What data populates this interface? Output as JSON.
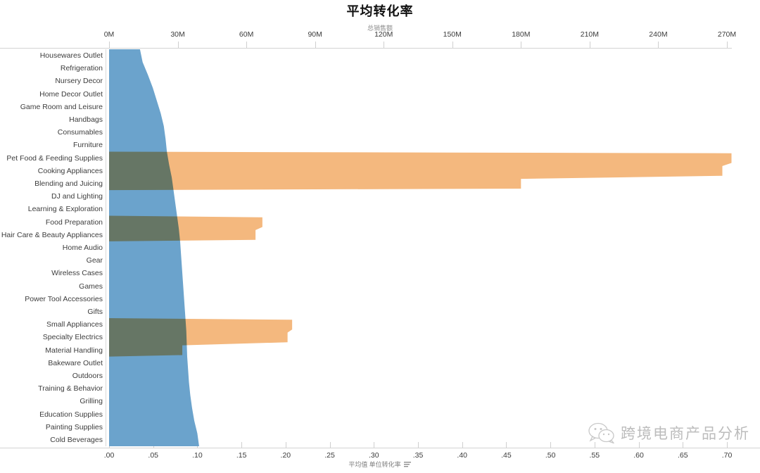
{
  "chart": {
    "title": "平均转化率",
    "top_axis_label": "总销售额",
    "bottom_axis_label": "平均值 单位转化率",
    "sort_icon": "sort-descending-icon"
  },
  "watermark": {
    "text": "跨境电商产品分析",
    "logo": "wechat-logo-icon"
  },
  "colors": {
    "blue": "#6ba3cc",
    "orange": "#f4b87e",
    "overlap": "#c09a68",
    "axis": "#d3d3d3",
    "text": "#3d3d3d"
  },
  "chart_data": {
    "type": "area",
    "orientation": "horizontal",
    "title": "平均转化率",
    "xlabel": "平均值 单位转化率",
    "x2label": "总销售额",
    "ylabel": "",
    "grid": false,
    "legend": null,
    "bottom_axis": {
      "name": "平均值 单位转化率",
      "ticks": [
        ".00",
        ".05",
        ".10",
        ".15",
        ".20",
        ".25",
        ".30",
        ".35",
        ".40",
        ".45",
        ".50",
        ".55",
        ".60",
        ".65",
        ".70"
      ],
      "tick_values": [
        0.0,
        0.05,
        0.1,
        0.15,
        0.2,
        0.25,
        0.3,
        0.35,
        0.4,
        0.45,
        0.5,
        0.55,
        0.6,
        0.65,
        0.7
      ],
      "range": [
        0.0,
        0.7
      ]
    },
    "top_axis": {
      "name": "总销售额",
      "ticks": [
        "0M",
        "30M",
        "60M",
        "90M",
        "120M",
        "150M",
        "180M",
        "210M",
        "240M",
        "270M"
      ],
      "tick_values": [
        0,
        30000000,
        60000000,
        90000000,
        120000000,
        150000000,
        180000000,
        210000000,
        240000000,
        270000000
      ],
      "range": [
        0,
        270000000
      ]
    },
    "categories": [
      "Housewares Outlet",
      "Refrigeration",
      "Nursery Decor",
      "Home Decor Outlet",
      "Game Room and Leisure",
      "Handbags",
      "Consumables",
      "Furniture",
      "Pet Food & Feeding Supplies",
      "Cooking Appliances",
      "Blending and Juicing",
      "DJ and Lighting",
      "Learning & Exploration",
      "Food Preparation",
      "Hair Care & Beauty Appliances",
      "Home Audio",
      "Gear",
      "Wireless Cases",
      "Games",
      "Power Tool Accessories",
      "Gifts",
      "Small Appliances",
      "Specialty Electrics",
      "Material Handling",
      "Bakeware Outlet",
      "Outdoors",
      "Training & Behavior",
      "Grilling",
      "Education Supplies",
      "Painting Supplies",
      "Cold Beverages"
    ],
    "series": [
      {
        "name": "平均值 单位转化率",
        "axis": "bottom",
        "color": "#6ba3cc",
        "values": [
          0.035,
          0.041,
          0.047,
          0.052,
          0.056,
          0.061,
          0.063,
          0.065,
          0.066,
          0.07,
          0.072,
          0.074,
          0.076,
          0.078,
          0.08,
          0.081,
          0.082,
          0.083,
          0.084,
          0.085,
          0.086,
          0.087,
          0.088,
          0.088,
          0.089,
          0.09,
          0.091,
          0.093,
          0.095,
          0.098,
          0.102
        ]
      },
      {
        "name": "总销售额",
        "axis": "top",
        "color": "#f4b87e",
        "values": [
          0,
          0,
          0,
          0,
          0,
          0,
          0,
          0,
          272000000,
          268000000,
          180000000,
          0,
          0,
          67000000,
          64000000,
          0,
          0,
          0,
          0,
          0,
          0,
          80000000,
          78000000,
          32000000,
          0,
          0,
          0,
          0,
          0,
          0,
          0
        ]
      }
    ],
    "notes": "Blue horizontal area (bottom axis, conversion rate) spans all rows; orange horizontal area (top axis, total sales) appears as wedges at Pet Food & Feeding Supplies–Blending and Juicing, Food Preparation–Hair Care & Beauty Appliances, and Small Appliances–Material Handling. Overlapping region renders brown."
  }
}
